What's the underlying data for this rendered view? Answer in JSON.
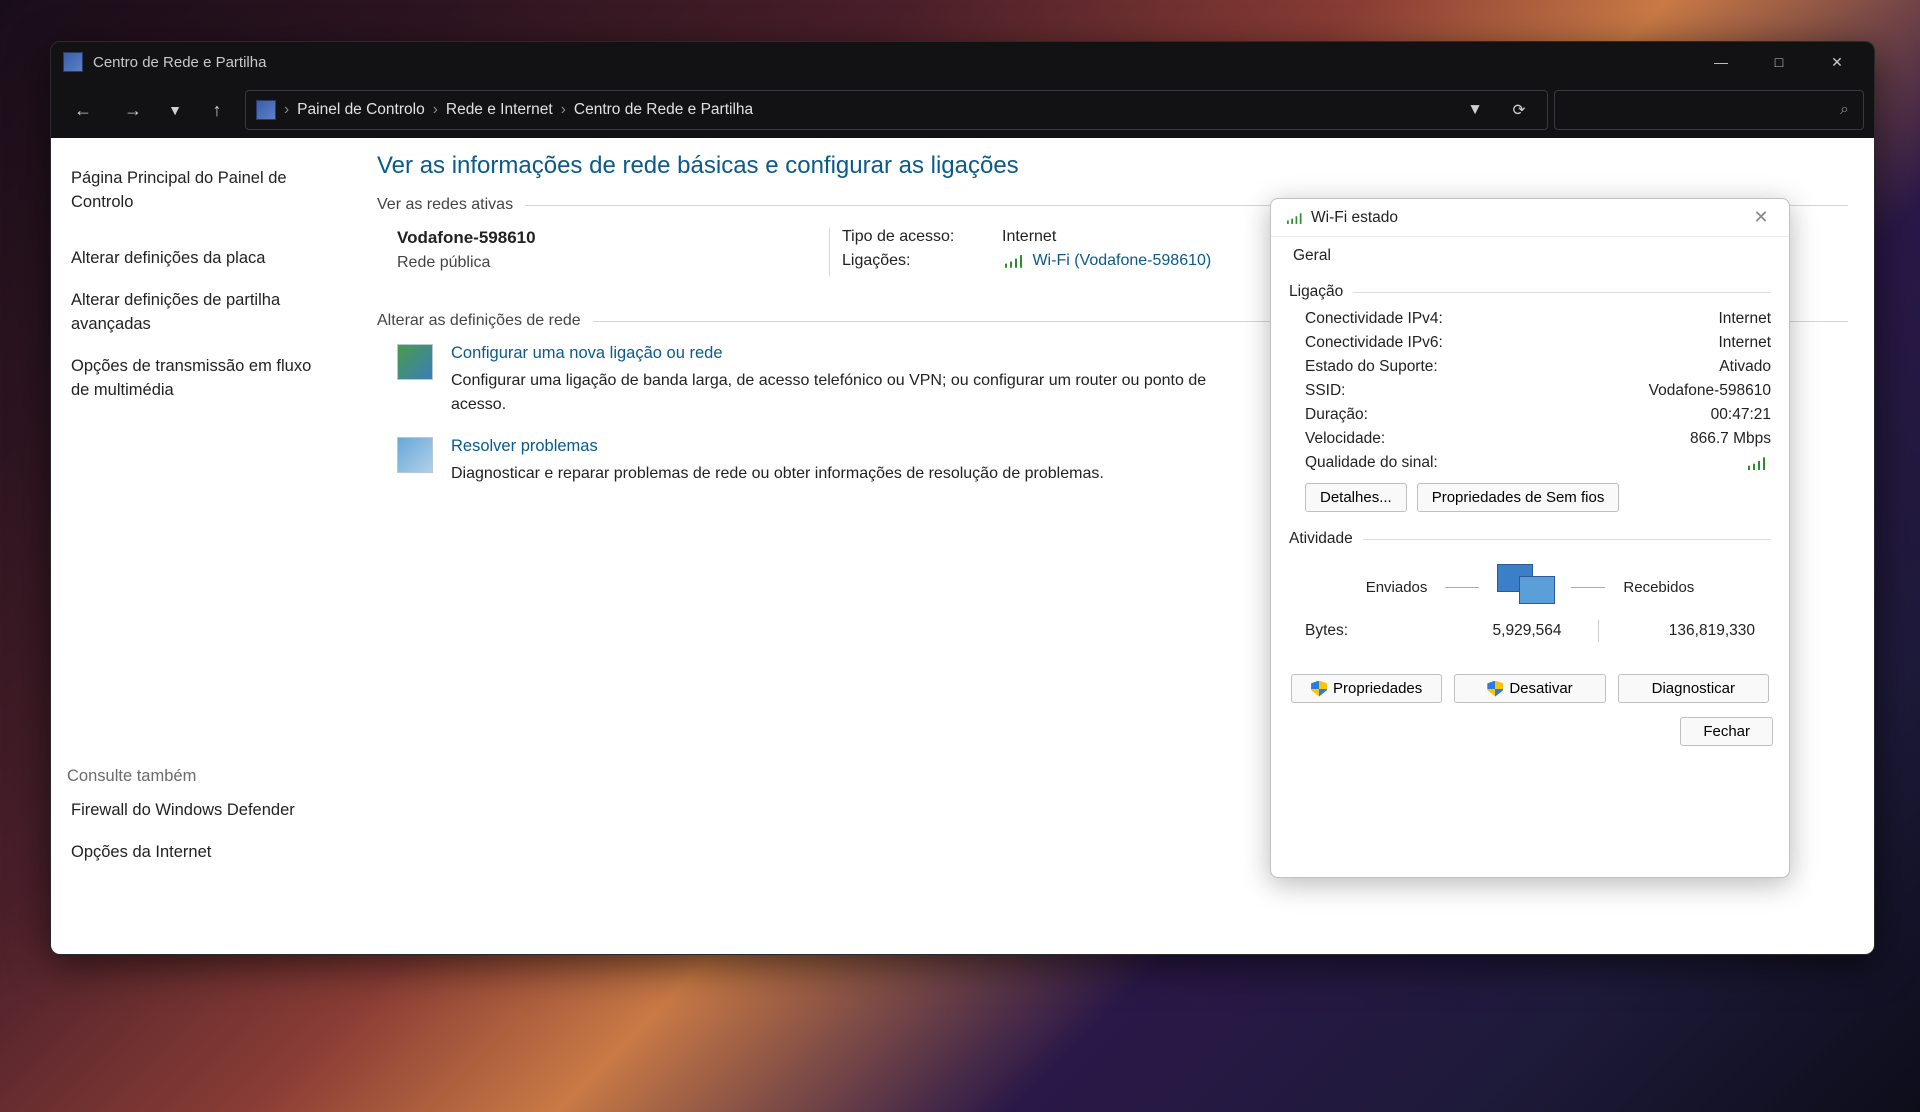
{
  "titlebar": {
    "title": "Centro de Rede e Partilha"
  },
  "breadcrumb": {
    "items": [
      "Painel de Controlo",
      "Rede e Internet",
      "Centro de Rede e Partilha"
    ]
  },
  "sidebar": {
    "items": [
      "Página Principal do Painel de Controlo",
      "Alterar definições da placa",
      "Alterar definições de partilha avançadas",
      "Opções de transmissão em fluxo de multimédia"
    ],
    "see_also_heading": "Consulte também",
    "see_also": [
      "Firewall do Windows Defender",
      "Opções da Internet"
    ]
  },
  "main": {
    "title": "Ver as informações de rede básicas e configurar as ligações",
    "active_networks_label": "Ver as redes ativas",
    "network": {
      "name": "Vodafone-598610",
      "type": "Rede pública"
    },
    "details": {
      "access_type_label": "Tipo de acesso:",
      "access_type_value": "Internet",
      "connections_label": "Ligações:",
      "connections_value": "Wi-Fi (Vodafone-598610)"
    },
    "change_settings_label": "Alterar as definições de rede",
    "tasks": [
      {
        "title": "Configurar uma nova ligação ou rede",
        "desc": "Configurar uma ligação de banda larga, de acesso telefónico ou VPN; ou configurar um router ou ponto de acesso."
      },
      {
        "title": "Resolver problemas",
        "desc": "Diagnosticar e reparar problemas de rede ou obter informações de resolução de problemas."
      }
    ]
  },
  "dialog": {
    "title": "Wi-Fi estado",
    "tab": "Geral",
    "connection_heading": "Ligação",
    "rows": [
      {
        "k": "Conectividade IPv4:",
        "v": "Internet"
      },
      {
        "k": "Conectividade IPv6:",
        "v": "Internet"
      },
      {
        "k": "Estado do Suporte:",
        "v": "Ativado"
      },
      {
        "k": "SSID:",
        "v": "Vodafone-598610"
      },
      {
        "k": "Duração:",
        "v": "00:47:21"
      },
      {
        "k": "Velocidade:",
        "v": "866.7 Mbps"
      }
    ],
    "signal_quality_label": "Qualidade do sinal:",
    "details_btn": "Detalhes...",
    "wifi_props_btn": "Propriedades de Sem fios",
    "activity_heading": "Atividade",
    "sent_label": "Enviados",
    "received_label": "Recebidos",
    "bytes_label": "Bytes:",
    "bytes_sent": "5,929,564",
    "bytes_received": "136,819,330",
    "properties_btn": "Propriedades",
    "disable_btn": "Desativar",
    "diagnose_btn": "Diagnosticar",
    "close_btn": "Fechar"
  }
}
